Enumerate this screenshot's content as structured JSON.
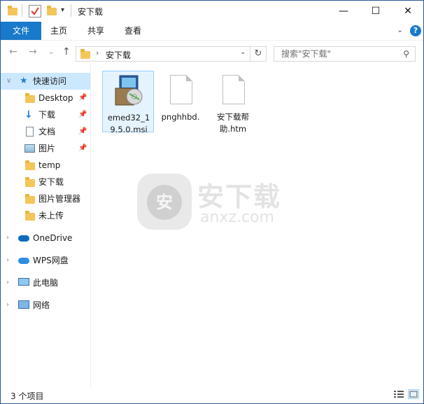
{
  "window": {
    "title": "安下载"
  },
  "title_controls": {
    "minimize": "—",
    "maximize": "☐",
    "close": "✕"
  },
  "ribbon": {
    "tabs": [
      {
        "label": "文件",
        "active": true
      },
      {
        "label": "主页"
      },
      {
        "label": "共享"
      },
      {
        "label": "查看"
      }
    ],
    "help_icon": "?"
  },
  "address": {
    "path": "安下载",
    "search_placeholder": "搜索\"安下载\""
  },
  "sidebar": {
    "quick_access": "快速访问",
    "pinned": [
      {
        "label": "Desktop",
        "icon": "folder-icon"
      },
      {
        "label": "下载",
        "icon": "download-icon"
      },
      {
        "label": "文档",
        "icon": "document-icon"
      },
      {
        "label": "图片",
        "icon": "picture-icon"
      }
    ],
    "folders": [
      {
        "label": "temp"
      },
      {
        "label": "安下载"
      },
      {
        "label": "图片管理器"
      },
      {
        "label": "未上传"
      }
    ],
    "roots": [
      {
        "label": "OneDrive",
        "icon": "cloud-icon"
      },
      {
        "label": "WPS网盘",
        "icon": "cloud-icon"
      },
      {
        "label": "此电脑",
        "icon": "computer-icon"
      },
      {
        "label": "网络",
        "icon": "network-icon"
      }
    ]
  },
  "files": [
    {
      "name_line1": "emed32_1",
      "name_line2": "9.5.0.msi",
      "icon": "installer-icon"
    },
    {
      "name_line1": "pnghhbd.",
      "name_line2": "",
      "icon": "file-icon"
    },
    {
      "name_line1": "安下载帮",
      "name_line2": "助.htm",
      "icon": "file-icon"
    }
  ],
  "watermark": {
    "text_cn": "安下载",
    "text_en": "anxz.com",
    "logo_char": "安"
  },
  "status": {
    "item_count": "3 个项目"
  },
  "colors": {
    "accent": "#1979ca",
    "selection": "#cce8ff",
    "folder": "#f3c65a"
  }
}
